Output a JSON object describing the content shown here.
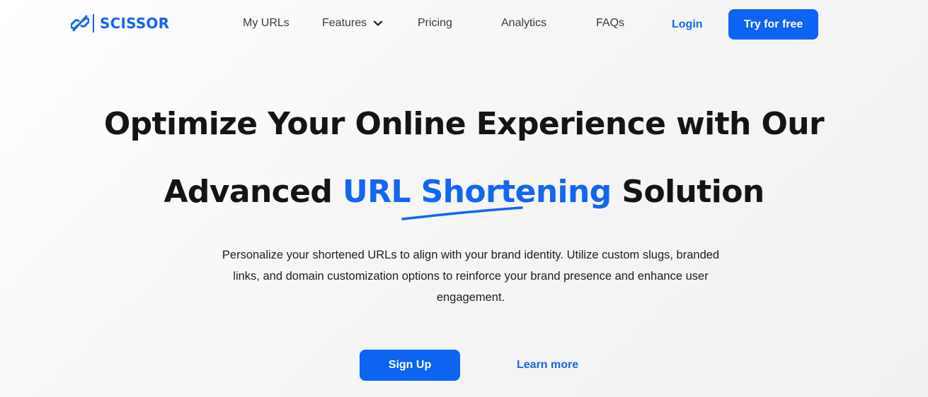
{
  "header": {
    "brand": "SCISSOR",
    "nav": {
      "my_urls": "My URLs",
      "features": "Features",
      "pricing": "Pricing",
      "analytics": "Analytics",
      "faqs": "FAQs"
    },
    "login_label": "Login",
    "try_label": "Try for free"
  },
  "hero": {
    "title_line1": "Optimize Your Online Experience with Our",
    "title_line2_prefix": "Advanced ",
    "title_line2_highlight": "URL Shortening",
    "title_line2_suffix": " Solution",
    "subtitle": "Personalize your shortened URLs to align with your brand identity. Utilize custom slugs, branded links, and domain customization options to reinforce your brand presence and enhance user engagement.",
    "signup_label": "Sign Up",
    "learn_more_label": "Learn more"
  },
  "colors": {
    "accent": "#1366f0",
    "button": "#0d63f2",
    "text": "#141414"
  },
  "icons": {
    "logo": "link-icon",
    "features_dropdown": "chevron-down-icon"
  }
}
